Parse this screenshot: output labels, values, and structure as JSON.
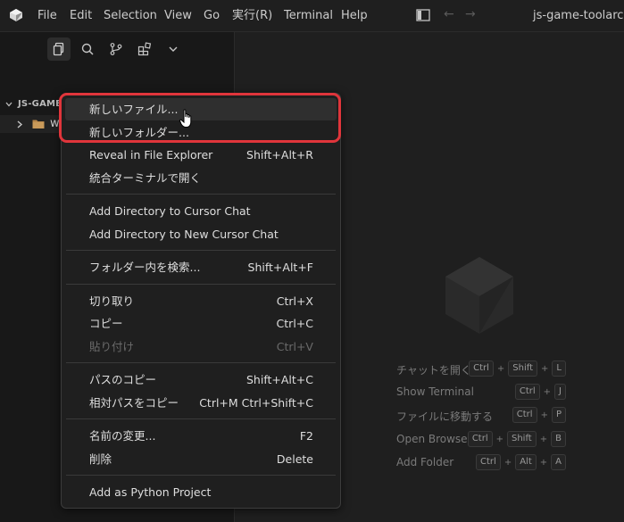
{
  "menubar": {
    "items": [
      "File",
      "Edit",
      "Selection",
      "View",
      "Go",
      "実行(R)",
      "Terminal",
      "Help"
    ],
    "window_title": "js-game-toolarc"
  },
  "sidebar": {
    "section_title": "JS-GAME-TOOLARC",
    "folder": "week01"
  },
  "context_menu": {
    "groups": [
      [
        {
          "label": "新しいファイル...",
          "shortcut": ""
        },
        {
          "label": "新しいフォルダー...",
          "shortcut": ""
        },
        {
          "label": "Reveal in File Explorer",
          "shortcut": "Shift+Alt+R"
        },
        {
          "label": "統合ターミナルで開く",
          "shortcut": ""
        }
      ],
      [
        {
          "label": "Add Directory to Cursor Chat",
          "shortcut": ""
        },
        {
          "label": "Add Directory to New Cursor Chat",
          "shortcut": ""
        }
      ],
      [
        {
          "label": "フォルダー内を検索...",
          "shortcut": "Shift+Alt+F"
        }
      ],
      [
        {
          "label": "切り取り",
          "shortcut": "Ctrl+X"
        },
        {
          "label": "コピー",
          "shortcut": "Ctrl+C"
        },
        {
          "label": "貼り付け",
          "shortcut": "Ctrl+V",
          "disabled": true
        }
      ],
      [
        {
          "label": "パスのコピー",
          "shortcut": "Shift+Alt+C"
        },
        {
          "label": "相対パスをコピー",
          "shortcut": "Ctrl+M Ctrl+Shift+C"
        }
      ],
      [
        {
          "label": "名前の変更...",
          "shortcut": "F2"
        },
        {
          "label": "削除",
          "shortcut": "Delete"
        }
      ],
      [
        {
          "label": "Add as Python Project",
          "shortcut": ""
        }
      ]
    ]
  },
  "shortcuts": [
    {
      "label": "チャットを開く",
      "keys": [
        "Ctrl",
        "Shift",
        "L"
      ]
    },
    {
      "label": "Show Terminal",
      "keys": [
        "Ctrl",
        "J"
      ]
    },
    {
      "label": "ファイルに移動する",
      "keys": [
        "Ctrl",
        "P"
      ]
    },
    {
      "label": "Open Browser",
      "keys": [
        "Ctrl",
        "Shift",
        "B"
      ]
    },
    {
      "label": "Add Folder",
      "keys": [
        "Ctrl",
        "Alt",
        "A"
      ]
    }
  ],
  "colors": {
    "highlight_border": "#e0353b",
    "background": "#181818",
    "menu_background": "#1f1f1f"
  },
  "icons": [
    "app-logo-icon",
    "layout-sidebar-icon",
    "back-arrow-icon",
    "forward-arrow-icon",
    "explorer-icon",
    "search-icon",
    "source-control-icon",
    "extensions-icon",
    "chevron-down-icon",
    "chevron-right-icon",
    "folder-icon",
    "cursor-logo-icon",
    "hand-pointer-icon"
  ]
}
